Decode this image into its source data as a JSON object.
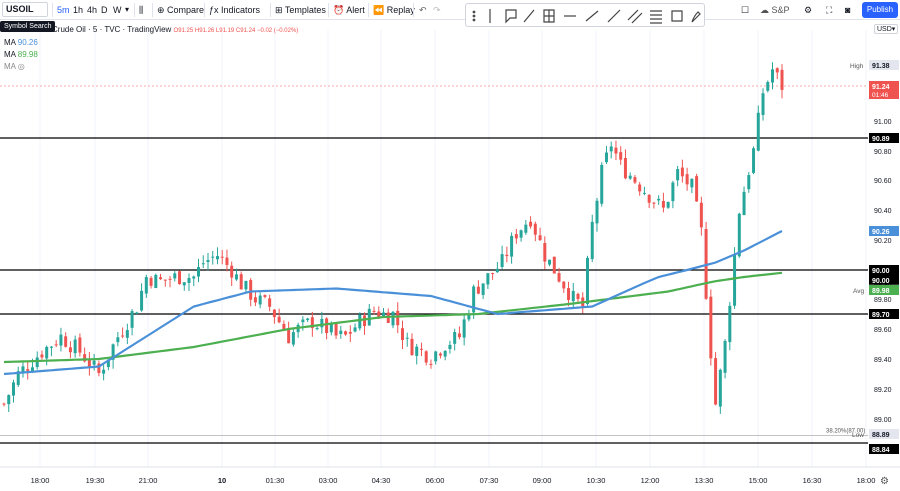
{
  "toolbar": {
    "symbol": "USOIL",
    "intervals": [
      "5m",
      "1h",
      "4h",
      "D",
      "W"
    ],
    "compare_label": "Compare",
    "indicators_label": "Indicators",
    "templates_label": "Templates",
    "alert_label": "Alert",
    "replay_label": "Replay",
    "sp_label": "S&P",
    "publish_label": "Publish",
    "tooltip": "Symbol Search"
  },
  "legend": {
    "title": "Crude Oil · 5 · TVC · TradingView",
    "ohlc": "O91.25 H91.26 L91.19 C91.24 −0.02 (−0.02%)",
    "ma1_label": "MA",
    "ma1_value": "90.26",
    "ma2_label": "MA",
    "ma2_value": "89.98",
    "ma3_label": "MA"
  },
  "currency": "USD",
  "colors": {
    "up": "#26a69a",
    "down": "#ef5350",
    "ma_blue": "#4a90d9",
    "ma_green": "#4caf50",
    "hline": "#000000",
    "price_label": "#ef5350",
    "ma_blue_label": "#4a90d9",
    "ma_green_label": "#4caf50"
  },
  "chart_data": {
    "type": "candlestick",
    "x_ticks": [
      "18:00",
      "19:30",
      "21:00",
      "10",
      "01:30",
      "03:00",
      "04:30",
      "06:00",
      "07:30",
      "09:00",
      "10:30",
      "12:00",
      "13:30",
      "15:00",
      "16:30",
      "18:00"
    ],
    "y_ticks": [
      "91.00",
      "90.80",
      "90.60",
      "90.40",
      "90.20",
      "89.90",
      "89.80",
      "89.60",
      "89.40",
      "89.20",
      "89.00"
    ],
    "ylim": [
      88.8,
      91.5
    ],
    "horizontal_levels": [
      {
        "value": 90.89,
        "label": "90.89"
      },
      {
        "value": 90.0,
        "label": "90.00"
      },
      {
        "value": 89.7,
        "label": "89.70"
      },
      {
        "value": 88.84,
        "label": "88.84"
      }
    ],
    "price_labels": [
      {
        "tag": "High",
        "value": "91.38"
      },
      {
        "tag": "",
        "value": "91.24",
        "sub": "01:46"
      },
      {
        "tag": "",
        "value": "90.26"
      },
      {
        "tag": "",
        "value": "90.00"
      },
      {
        "tag": "Avg",
        "value": "89.98"
      },
      {
        "tag": "Low",
        "value": "88.89"
      }
    ],
    "fib_label": "38.20%(87.00)",
    "close_path": [
      [
        0,
        89.1
      ],
      [
        3,
        89.3
      ],
      [
        8,
        89.45
      ],
      [
        12,
        89.55
      ],
      [
        16,
        89.45
      ],
      [
        20,
        89.3
      ],
      [
        24,
        89.55
      ],
      [
        28,
        89.75
      ],
      [
        30,
        89.95
      ],
      [
        33,
        89.92
      ],
      [
        36,
        89.95
      ],
      [
        40,
        89.95
      ],
      [
        42,
        90.05
      ],
      [
        45,
        90.1
      ],
      [
        48,
        90.0
      ],
      [
        50,
        89.9
      ],
      [
        53,
        89.8
      ],
      [
        56,
        89.75
      ],
      [
        58,
        89.65
      ],
      [
        60,
        89.55
      ],
      [
        62,
        89.6
      ],
      [
        65,
        89.65
      ],
      [
        68,
        89.6
      ],
      [
        70,
        89.55
      ],
      [
        72,
        89.55
      ],
      [
        75,
        89.65
      ],
      [
        78,
        89.72
      ],
      [
        80,
        89.7
      ],
      [
        82,
        89.7
      ],
      [
        85,
        89.5
      ],
      [
        88,
        89.45
      ],
      [
        90,
        89.42
      ],
      [
        93,
        89.5
      ],
      [
        96,
        89.55
      ],
      [
        99,
        89.85
      ],
      [
        102,
        89.95
      ],
      [
        105,
        90.05
      ],
      [
        108,
        90.25
      ],
      [
        111,
        90.35
      ],
      [
        114,
        90.1
      ],
      [
        117,
        89.95
      ],
      [
        120,
        89.8
      ],
      [
        122,
        89.75
      ],
      [
        124,
        90.3
      ],
      [
        126,
        90.65
      ],
      [
        128,
        90.85
      ],
      [
        130,
        90.7
      ],
      [
        133,
        90.6
      ],
      [
        136,
        90.5
      ],
      [
        139,
        90.4
      ],
      [
        142,
        90.65
      ],
      [
        145,
        90.55
      ],
      [
        147,
        90.25
      ],
      [
        149,
        89.45
      ],
      [
        150,
        89.1
      ],
      [
        152,
        89.5
      ],
      [
        155,
        90.4
      ],
      [
        158,
        90.8
      ],
      [
        160,
        91.2
      ],
      [
        162,
        91.35
      ],
      [
        164,
        91.24
      ]
    ],
    "ma_blue": [
      [
        0,
        89.3
      ],
      [
        20,
        89.35
      ],
      [
        40,
        89.75
      ],
      [
        52,
        89.85
      ],
      [
        70,
        89.87
      ],
      [
        90,
        89.82
      ],
      [
        104,
        89.7
      ],
      [
        124,
        89.75
      ],
      [
        138,
        89.95
      ],
      [
        150,
        90.05
      ],
      [
        156,
        90.13
      ],
      [
        164,
        90.26
      ]
    ],
    "ma_green": [
      [
        0,
        89.38
      ],
      [
        20,
        89.4
      ],
      [
        40,
        89.48
      ],
      [
        60,
        89.6
      ],
      [
        80,
        89.68
      ],
      [
        100,
        89.7
      ],
      [
        120,
        89.77
      ],
      [
        140,
        89.85
      ],
      [
        150,
        89.92
      ],
      [
        156,
        89.95
      ],
      [
        164,
        89.98
      ]
    ]
  }
}
